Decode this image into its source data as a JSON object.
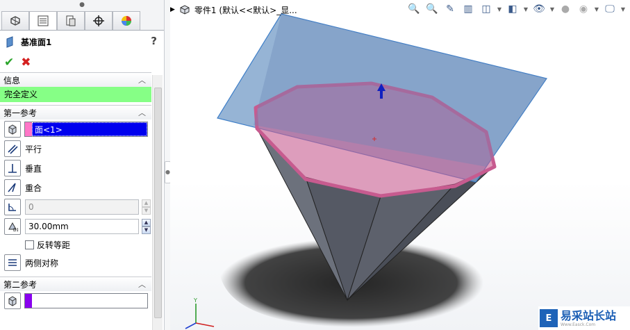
{
  "panel": {
    "title": "基准面1",
    "help": "?",
    "ok_label": "✔",
    "cancel_label": "✖",
    "tabs": [
      "feature-manager",
      "property-manager",
      "configuration-manager",
      "dimxpert-manager",
      "display-manager"
    ],
    "info": {
      "header": "信息",
      "message": "完全定义"
    },
    "first_ref": {
      "header": "第一参考",
      "selection": "面<1>",
      "options": {
        "parallel": "平行",
        "perpendicular": "垂直",
        "coincident": "重合"
      },
      "angle_value": "0",
      "distance_value": "30.00mm",
      "flip_label": "反转等距",
      "mid_label": "两侧对称"
    },
    "second_ref": {
      "header": "第二参考",
      "selection": ""
    }
  },
  "viewport": {
    "tree_label": "零件1  (默认<<默认>_显...",
    "colors": {
      "plane": "#7fa4cc",
      "plane_edge": "#3d7ec8",
      "face_highlight": "#c75b8f",
      "body": "#5f6470"
    }
  },
  "watermark": {
    "text": "易采站长站",
    "sub": "Www.Easck.Com"
  }
}
